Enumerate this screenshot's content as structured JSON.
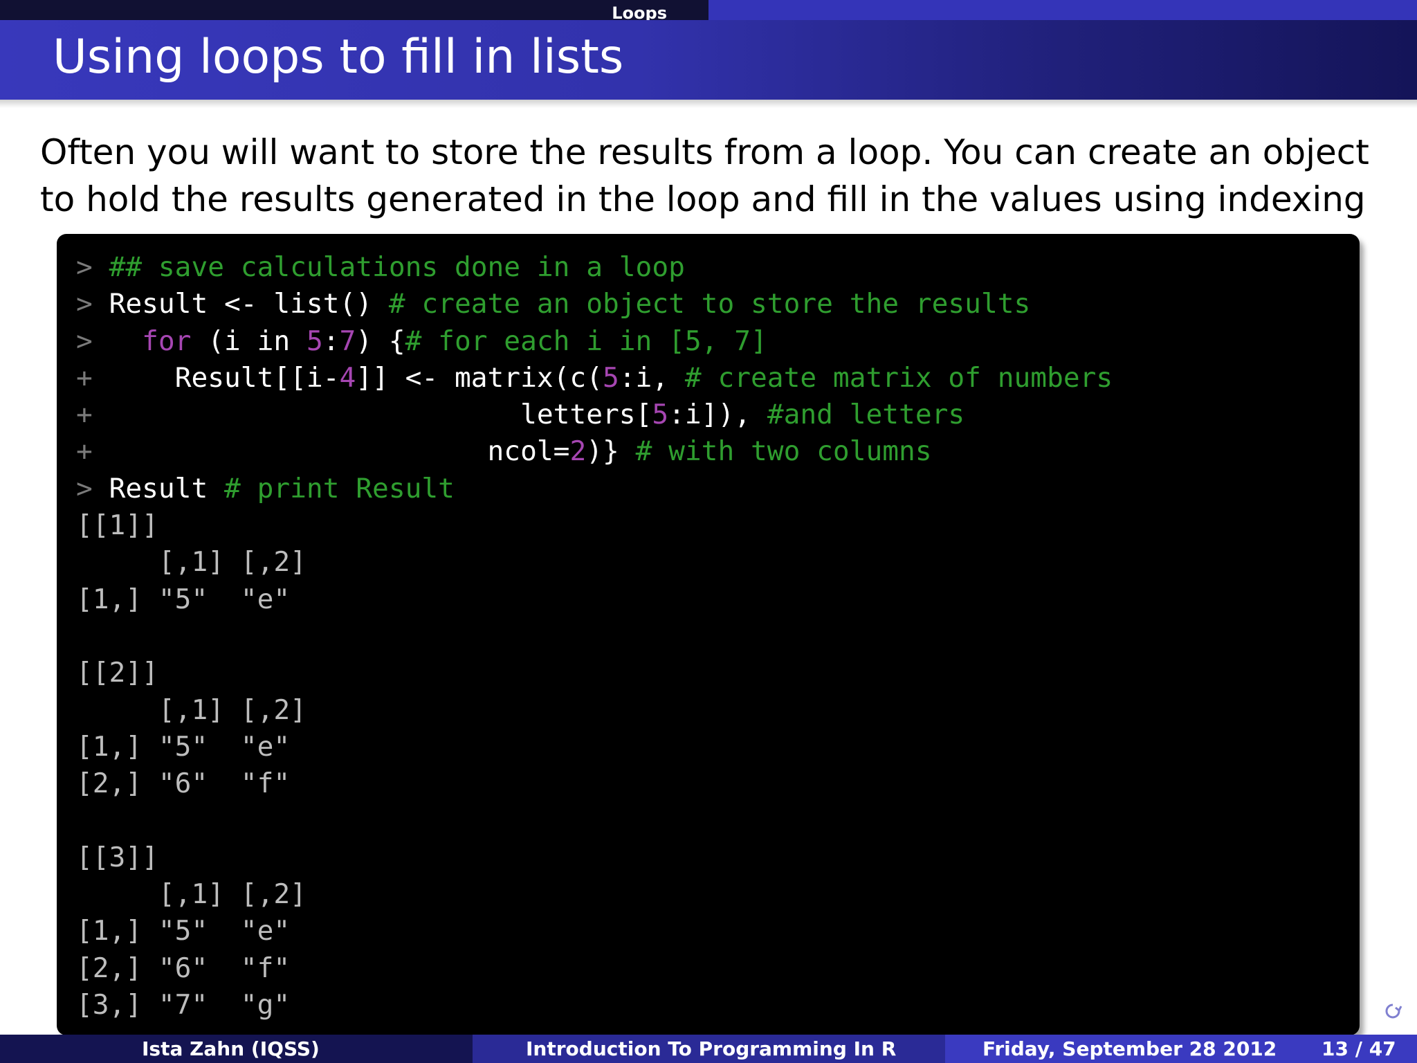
{
  "header": {
    "section": "Loops",
    "title": "Using loops to fill in lists"
  },
  "intro": {
    "text": "Often you will want to store the results from a loop. You can create an object to hold the results generated in the loop and fill in the values using indexing"
  },
  "code": {
    "lines": [
      [
        {
          "t": "> ",
          "c": "p"
        },
        {
          "t": "## save calculations done in a loop",
          "c": "c"
        }
      ],
      [
        {
          "t": "> ",
          "c": "p"
        },
        {
          "t": "Result <- list() ",
          "c": "t"
        },
        {
          "t": "# create an object to store the results",
          "c": "c"
        }
      ],
      [
        {
          "t": ">   ",
          "c": "p"
        },
        {
          "t": "for",
          "c": "k"
        },
        {
          "t": " (i in ",
          "c": "t"
        },
        {
          "t": "5",
          "c": "n"
        },
        {
          "t": ":",
          "c": "t"
        },
        {
          "t": "7",
          "c": "n"
        },
        {
          "t": ") {",
          "c": "t"
        },
        {
          "t": "# for each i in [5, 7]",
          "c": "c"
        }
      ],
      [
        {
          "t": "+     ",
          "c": "p"
        },
        {
          "t": "Result[[i-",
          "c": "t"
        },
        {
          "t": "4",
          "c": "n"
        },
        {
          "t": "]] <- matrix(c(",
          "c": "t"
        },
        {
          "t": "5",
          "c": "n"
        },
        {
          "t": ":i, ",
          "c": "t"
        },
        {
          "t": "# create matrix of numbers",
          "c": "c"
        }
      ],
      [
        {
          "t": "+                          ",
          "c": "p"
        },
        {
          "t": "letters[",
          "c": "t"
        },
        {
          "t": "5",
          "c": "n"
        },
        {
          "t": ":i]), ",
          "c": "t"
        },
        {
          "t": "#and letters",
          "c": "c"
        }
      ],
      [
        {
          "t": "+                        ",
          "c": "p"
        },
        {
          "t": "ncol=",
          "c": "t"
        },
        {
          "t": "2",
          "c": "n"
        },
        {
          "t": ")} ",
          "c": "t"
        },
        {
          "t": "# with two columns",
          "c": "c"
        }
      ],
      [
        {
          "t": "> ",
          "c": "p"
        },
        {
          "t": "Result ",
          "c": "t"
        },
        {
          "t": "# print Result",
          "c": "c"
        }
      ],
      [
        {
          "t": "[[1]]",
          "c": "o"
        }
      ],
      [
        {
          "t": "     [,1] [,2]",
          "c": "o"
        }
      ],
      [
        {
          "t": "[1,] \"5\"  \"e\"",
          "c": "o"
        }
      ],
      [
        {
          "t": "",
          "c": "o"
        }
      ],
      [
        {
          "t": "[[2]]",
          "c": "o"
        }
      ],
      [
        {
          "t": "     [,1] [,2]",
          "c": "o"
        }
      ],
      [
        {
          "t": "[1,] \"5\"  \"e\"",
          "c": "o"
        }
      ],
      [
        {
          "t": "[2,] \"6\"  \"f\"",
          "c": "o"
        }
      ],
      [
        {
          "t": "",
          "c": "o"
        }
      ],
      [
        {
          "t": "[[3]]",
          "c": "o"
        }
      ],
      [
        {
          "t": "     [,1] [,2]",
          "c": "o"
        }
      ],
      [
        {
          "t": "[1,] \"5\"  \"e\"",
          "c": "o"
        }
      ],
      [
        {
          "t": "[2,] \"6\"  \"f\"",
          "c": "o"
        }
      ],
      [
        {
          "t": "[3,] \"7\"  \"g\"",
          "c": "o"
        }
      ]
    ]
  },
  "footer": {
    "author": "Ista Zahn  (IQSS)",
    "title": "Introduction To Programming In R",
    "date": "Friday, September 28 2012",
    "page": "13 / 47"
  },
  "colors": {
    "comment": "#2f9e2f",
    "number_keyword": "#a646b2",
    "prompt": "#7a7a7a",
    "output": "#bdbdbd",
    "title_bar": "#3434b8"
  },
  "icons": {
    "navigation": "beamer-search-icon"
  }
}
